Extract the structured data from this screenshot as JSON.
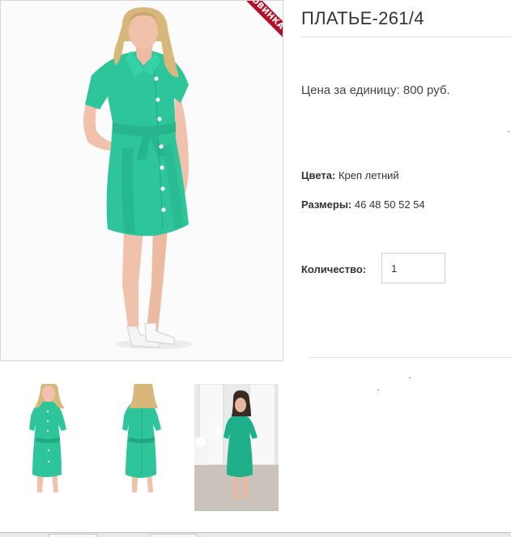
{
  "product": {
    "title": "ПЛАТЬЕ-261/4",
    "badge": "НОВИНКА",
    "price_label": "Цена за единицу:",
    "price_value": "800 руб.",
    "colors_label": "Цвета:",
    "colors_value": "Креп летний",
    "sizes_label": "Размеры:",
    "sizes_value": "46 48 50 52 54",
    "quantity_label": "Количество:",
    "quantity_value": "1"
  },
  "thumbnails": [
    {
      "name": "front view"
    },
    {
      "name": "back view"
    },
    {
      "name": "interior view"
    }
  ],
  "colors": {
    "dress": "#2fc59a",
    "dress_shade": "#22a881",
    "badge": "#b3102a",
    "skin": "#f1c2ab",
    "hair_blonde": "#d8b77a",
    "hair_dark": "#3b2a22"
  }
}
